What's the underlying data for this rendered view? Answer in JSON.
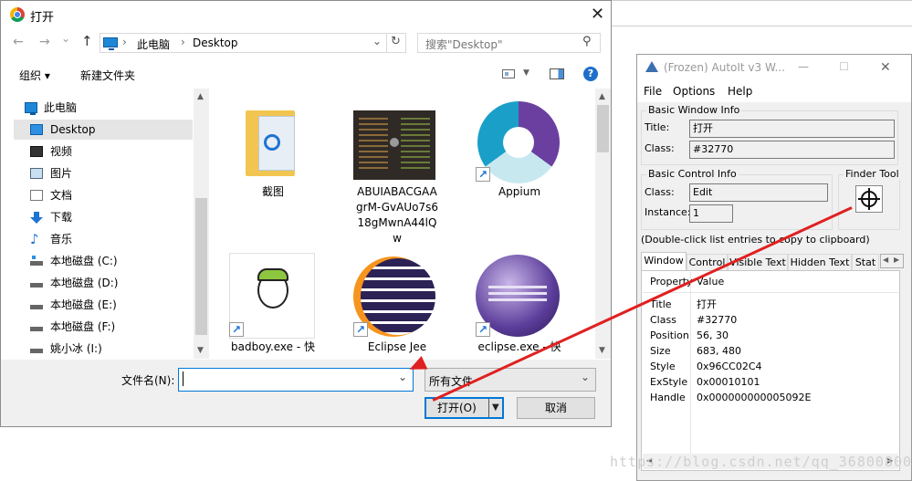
{
  "dialog": {
    "title": "打开",
    "close_glyph": "✕",
    "nav": {
      "back": "←",
      "forward": "→",
      "down": "⌄",
      "up": "↑"
    },
    "breadcrumb": [
      "此电脑",
      "Desktop"
    ],
    "breadcrumb_sep": "›",
    "search_placeholder": "搜索\"Desktop\"",
    "toolbar": {
      "organize": "组织 ▾",
      "new_folder": "新建文件夹"
    },
    "nav_items": [
      {
        "label": "此电脑",
        "icon": "computer-icon"
      },
      {
        "label": "Desktop",
        "icon": "desktop-icon",
        "selected": true
      },
      {
        "label": "视频",
        "icon": "video-icon"
      },
      {
        "label": "图片",
        "icon": "pictures-icon"
      },
      {
        "label": "文档",
        "icon": "documents-icon"
      },
      {
        "label": "下载",
        "icon": "download-icon"
      },
      {
        "label": "音乐",
        "icon": "music-icon"
      },
      {
        "label": "本地磁盘 (C:)",
        "icon": "drive-icon"
      },
      {
        "label": "本地磁盘 (D:)",
        "icon": "drive-icon"
      },
      {
        "label": "本地磁盘 (E:)",
        "icon": "drive-icon"
      },
      {
        "label": "本地磁盘 (F:)",
        "icon": "drive-icon"
      },
      {
        "label": "姚小冰 (I:)",
        "icon": "drive-icon"
      }
    ],
    "files": [
      {
        "name": "截图",
        "lines": [
          "截图"
        ]
      },
      {
        "name": "ABUIABACGAAgrM-GvAUo7s618gMwnA44lQw",
        "lines": [
          "ABUIABACGAA",
          "grM-GvAUo7s6",
          "18gMwnA44lQ",
          "w"
        ]
      },
      {
        "name": "Appium",
        "lines": [
          "Appium"
        ]
      },
      {
        "name": "badboy.exe - 快",
        "lines": [
          "badboy.exe - 快"
        ]
      },
      {
        "name": "Eclipse Jee",
        "lines": [
          "Eclipse Jee"
        ]
      },
      {
        "name": "eclipse.exe - 快",
        "lines": [
          "eclipse.exe - 快"
        ]
      }
    ],
    "filename_label": "文件名(N):",
    "filename_value": "",
    "filetype": "所有文件",
    "open_button": "打开(O)",
    "cancel_button": "取消",
    "colors": {
      "selected_bg": "#e5e5e5",
      "accent": "#0078d7"
    }
  },
  "autoit": {
    "title": "(Frozen) AutoIt v3 W...",
    "min_glyph": "—",
    "max_glyph": "☐",
    "close_glyph": "✕",
    "menu": [
      "File",
      "Options",
      "Help"
    ],
    "basic_window_info": "Basic Window Info",
    "title_label": "Title:",
    "title_value": "打开",
    "class_label": "Class:",
    "class_value": "#32770",
    "basic_control_info": "Basic Control Info",
    "ctrl_class_label": "Class:",
    "ctrl_class_value": "Edit",
    "instance_label": "Instance:",
    "instance_value": "1",
    "finder_tool": "Finder Tool",
    "hint": "(Double-click list entries to copy to clipboard)",
    "tabs": [
      "Window",
      "Control",
      "Visible Text",
      "Hidden Text",
      "Stat"
    ],
    "col_property": "Property",
    "col_value": "Value",
    "properties": [
      {
        "k": "Title",
        "v": "打开"
      },
      {
        "k": "Class",
        "v": "#32770"
      },
      {
        "k": "Position",
        "v": "56, 30"
      },
      {
        "k": "Size",
        "v": "683, 480"
      },
      {
        "k": "Style",
        "v": "0x96CC02C4"
      },
      {
        "k": "ExStyle",
        "v": "0x00010101"
      },
      {
        "k": "Handle",
        "v": "0x000000000005092E"
      }
    ],
    "colors": {
      "arrow": "#e02020"
    }
  },
  "watermark": "https://blog.csdn.net/qq_36800800"
}
